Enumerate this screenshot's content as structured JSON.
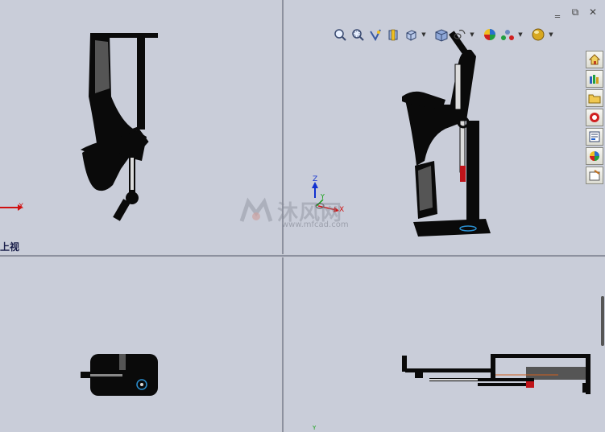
{
  "viewports": {
    "top_left": {
      "view_label": "上视",
      "axis_x": "X"
    },
    "top_right": {
      "axis_x": "X",
      "axis_y": "Y",
      "axis_z": "Z"
    },
    "bottom_right": {
      "axis_y": "Y"
    }
  },
  "window_controls": {
    "minimize": "‗",
    "restore": "⧉",
    "close": "✕"
  },
  "heads_up_toolbar": [
    {
      "name": "zoom-to-fit",
      "icon": "magnifier-icon",
      "dropdown": false
    },
    {
      "name": "zoom-to-area",
      "icon": "magnifier-area-icon",
      "dropdown": false
    },
    {
      "name": "previous-view",
      "icon": "previous-view-icon",
      "dropdown": false
    },
    {
      "name": "section-view",
      "icon": "section-view-icon",
      "dropdown": false
    },
    {
      "name": "view-orientation",
      "icon": "view-orientation-icon",
      "dropdown": true
    },
    {
      "name": "display-style",
      "icon": "display-style-icon",
      "dropdown": true
    },
    {
      "name": "hide-show-items",
      "icon": "hide-show-icon",
      "dropdown": true
    },
    {
      "name": "edit-appearance",
      "icon": "appearance-icon",
      "dropdown": false
    },
    {
      "name": "apply-scene",
      "icon": "scene-icon",
      "dropdown": true
    },
    {
      "name": "view-settings",
      "icon": "view-settings-icon",
      "dropdown": true
    }
  ],
  "task_pane": [
    {
      "name": "solidworks-resources",
      "icon": "home-icon"
    },
    {
      "name": "design-library",
      "icon": "design-library-icon"
    },
    {
      "name": "file-explorer",
      "icon": "folder-icon"
    },
    {
      "name": "view-palette",
      "icon": "view-palette-icon"
    },
    {
      "name": "search",
      "icon": "search-results-icon"
    },
    {
      "name": "appearances",
      "icon": "appearance-sphere-icon"
    },
    {
      "name": "custom-properties",
      "icon": "custom-properties-icon"
    }
  ],
  "watermark": {
    "text": "沐风网",
    "url": "www.mfcad.com"
  },
  "colors": {
    "background": "#c9cdd9",
    "model": "#0a0a0a",
    "axis_x": "#d01010",
    "axis_y": "#10a010",
    "axis_z": "#1030d0"
  }
}
